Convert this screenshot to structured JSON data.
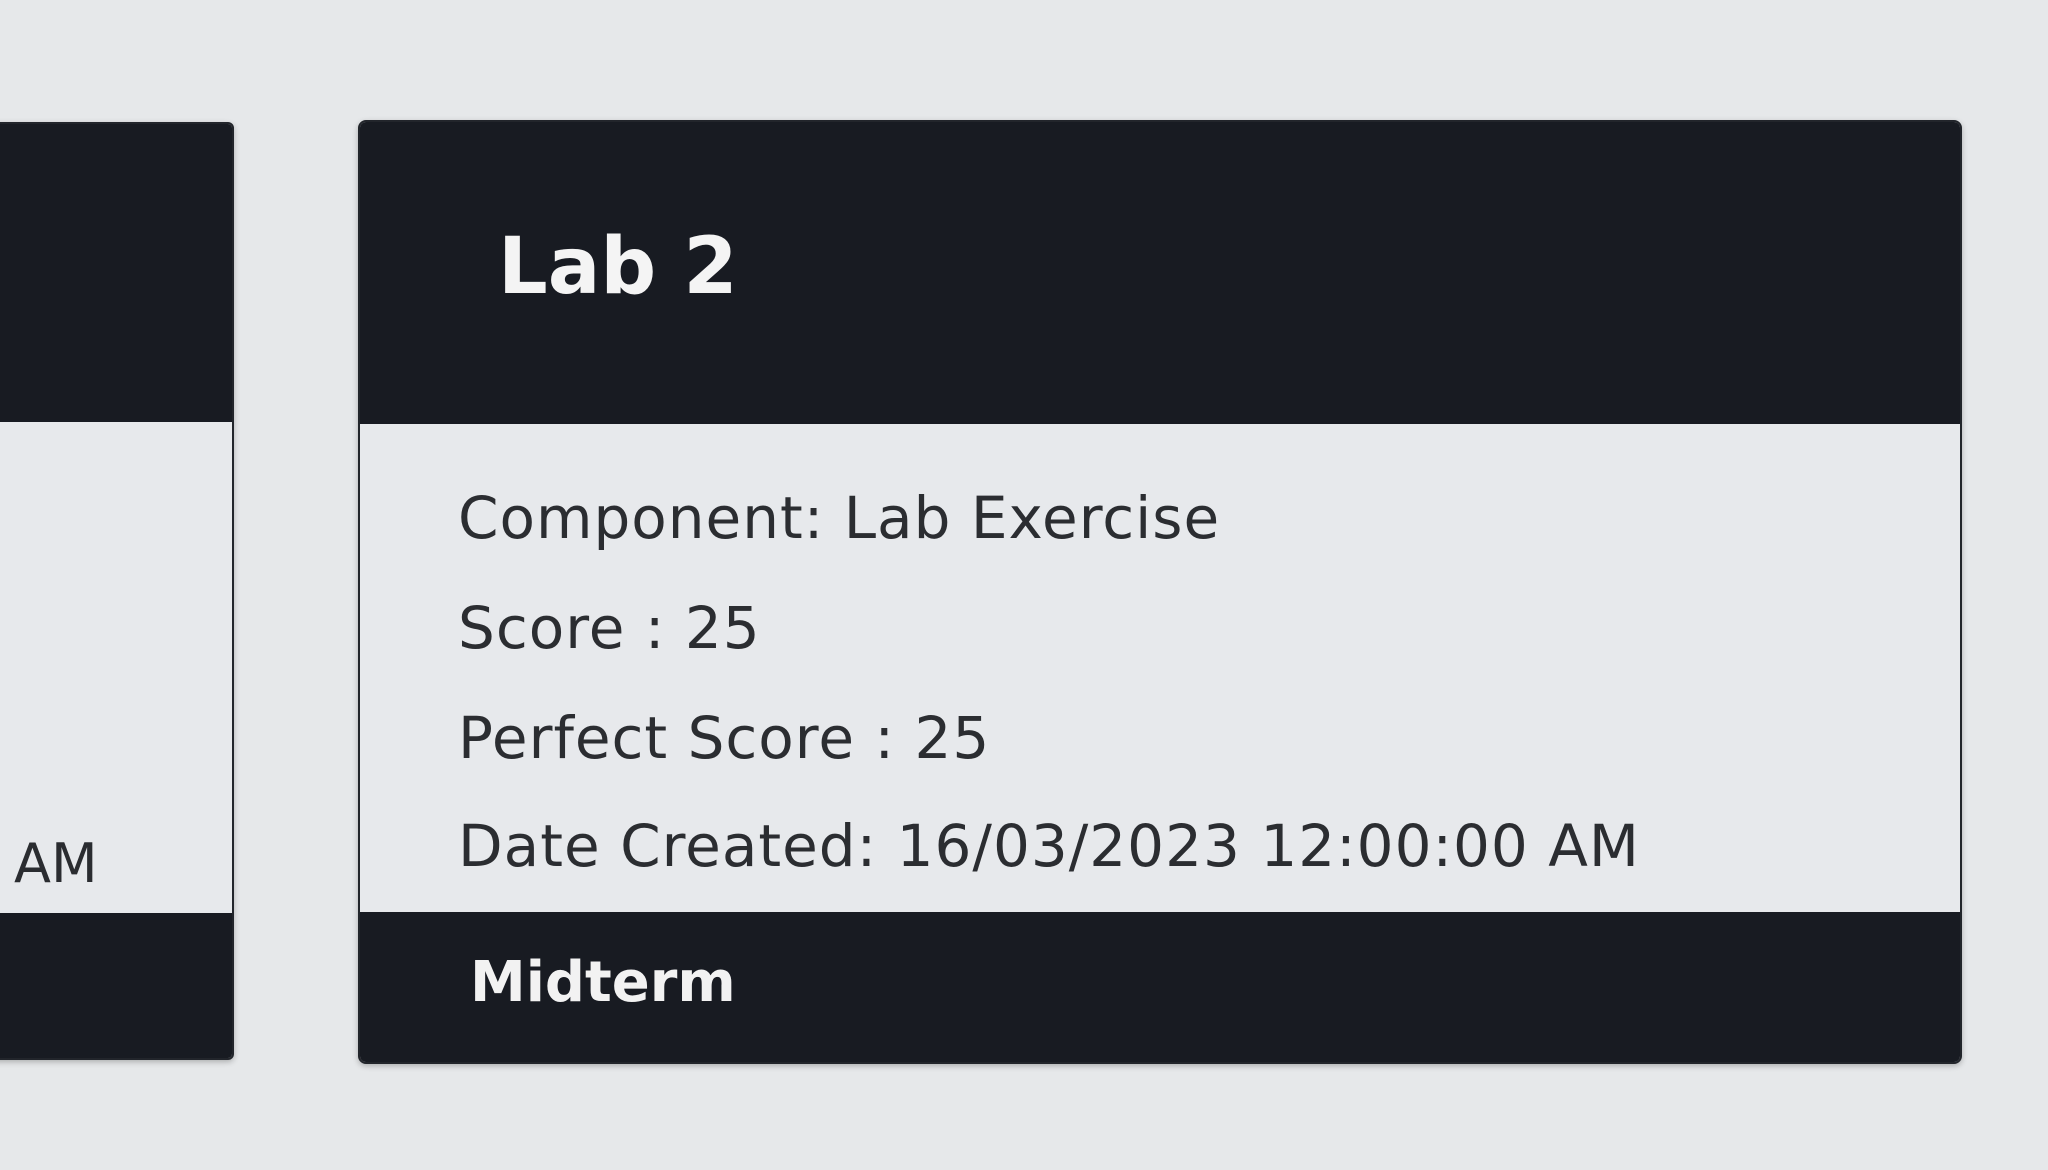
{
  "left_card": {
    "time_suffix": "AM"
  },
  "card": {
    "title": "Lab 2",
    "component_label": "Component:",
    "component_value": "Lab Exercise",
    "score_label": "Score :",
    "score_value": "25",
    "perfect_score_label": "Perfect Score :",
    "perfect_score_value": "25",
    "date_created_label": "Date Created:",
    "date_created_value": "16/03/2023 12:00:00 AM",
    "footer": "Midterm"
  }
}
